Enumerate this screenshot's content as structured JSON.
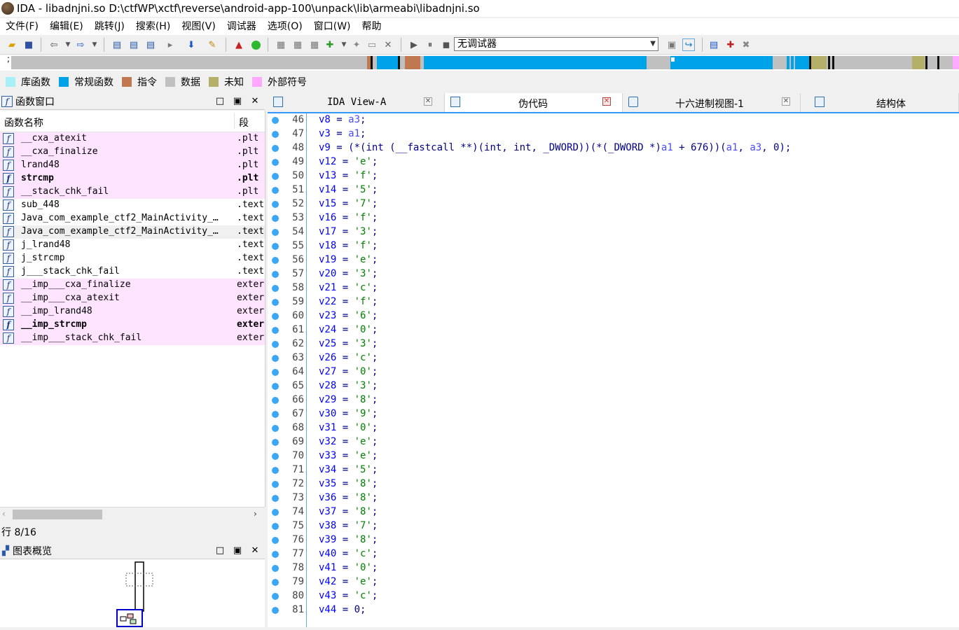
{
  "window": {
    "title": "IDA - libadnjni.so D:\\ctfWP\\xctf\\reverse\\android-app-100\\unpack\\lib\\armeabi\\libadnjni.so"
  },
  "menu": [
    "文件(F)",
    "编辑(E)",
    "跳转(J)",
    "搜索(H)",
    "视图(V)",
    "调试器",
    "选项(O)",
    "窗口(W)",
    "帮助"
  ],
  "toolbar": {
    "debugger_select": "无调试器"
  },
  "nav_band": {
    "prefix": ";"
  },
  "legend": [
    {
      "label": "库函数",
      "color": "#a8f0f8"
    },
    {
      "label": "常规函数",
      "color": "#00a2e8"
    },
    {
      "label": "指令",
      "color": "#c07850"
    },
    {
      "label": "数据",
      "color": "#c0c0c0"
    },
    {
      "label": "未知",
      "color": "#b4b06a"
    },
    {
      "label": "外部符号",
      "color": "#ffa8ff"
    }
  ],
  "functions_window": {
    "title": "函数窗口",
    "col_name": "函数名称",
    "col_segment": "段",
    "rows": [
      {
        "name": "__cxa_atexit",
        "segment": ".plt"
      },
      {
        "name": "__cxa_finalize",
        "segment": ".plt"
      },
      {
        "name": "lrand48",
        "segment": ".plt"
      },
      {
        "name": "strcmp",
        "segment": ".plt"
      },
      {
        "name": "__stack_chk_fail",
        "segment": ".plt"
      },
      {
        "name": "sub_448",
        "segment": ".text"
      },
      {
        "name": "Java_com_example_ctf2_MainActivity_…",
        "segment": ".text"
      },
      {
        "name": "Java_com_example_ctf2_MainActivity_…",
        "segment": ".text"
      },
      {
        "name": "j_lrand48",
        "segment": ".text"
      },
      {
        "name": "j_strcmp",
        "segment": ".text"
      },
      {
        "name": "j___stack_chk_fail",
        "segment": ".text"
      },
      {
        "name": "__imp___cxa_finalize",
        "segment": "exter"
      },
      {
        "name": "__imp___cxa_atexit",
        "segment": "exter"
      },
      {
        "name": "__imp_lrand48",
        "segment": "exter"
      },
      {
        "name": "__imp_strcmp",
        "segment": "exter"
      },
      {
        "name": "__imp___stack_chk_fail",
        "segment": "exter"
      }
    ],
    "row_count": "行 8/16"
  },
  "graph_overview": {
    "title": "图表概览"
  },
  "tabs": [
    {
      "label": "IDA View-A"
    },
    {
      "label": "伪代码"
    },
    {
      "label": "十六进制视图-1"
    },
    {
      "label": "结构体"
    }
  ],
  "code": {
    "line48": {
      "pre": "(*(int (__fastcall **)(int, int, _DWORD))(*(_DWORD *)",
      "a1": "a1",
      "mid": " + 676))(",
      "args_a1": "a1",
      ", ": ", ",
      "args_a3": "a3",
      "post": ", 0);"
    },
    "lines": [
      {
        "n": "46",
        "var": "v8",
        "rhs": "a3",
        "kind": "arg"
      },
      {
        "n": "47",
        "var": "v3",
        "rhs": "a1",
        "kind": "arg"
      },
      {
        "n": "48",
        "var": "v9",
        "rhs": "",
        "kind": "call"
      },
      {
        "n": "49",
        "var": "v12",
        "rhs": "'e'",
        "kind": "str"
      },
      {
        "n": "50",
        "var": "v13",
        "rhs": "'f'",
        "kind": "str"
      },
      {
        "n": "51",
        "var": "v14",
        "rhs": "'5'",
        "kind": "str"
      },
      {
        "n": "52",
        "var": "v15",
        "rhs": "'7'",
        "kind": "str"
      },
      {
        "n": "53",
        "var": "v16",
        "rhs": "'f'",
        "kind": "str"
      },
      {
        "n": "54",
        "var": "v17",
        "rhs": "'3'",
        "kind": "str"
      },
      {
        "n": "55",
        "var": "v18",
        "rhs": "'f'",
        "kind": "str"
      },
      {
        "n": "56",
        "var": "v19",
        "rhs": "'e'",
        "kind": "str"
      },
      {
        "n": "57",
        "var": "v20",
        "rhs": "'3'",
        "kind": "str"
      },
      {
        "n": "58",
        "var": "v21",
        "rhs": "'c'",
        "kind": "str"
      },
      {
        "n": "59",
        "var": "v22",
        "rhs": "'f'",
        "kind": "str"
      },
      {
        "n": "60",
        "var": "v23",
        "rhs": "'6'",
        "kind": "str"
      },
      {
        "n": "61",
        "var": "v24",
        "rhs": "'0'",
        "kind": "str"
      },
      {
        "n": "62",
        "var": "v25",
        "rhs": "'3'",
        "kind": "str"
      },
      {
        "n": "63",
        "var": "v26",
        "rhs": "'c'",
        "kind": "str"
      },
      {
        "n": "64",
        "var": "v27",
        "rhs": "'0'",
        "kind": "str"
      },
      {
        "n": "65",
        "var": "v28",
        "rhs": "'3'",
        "kind": "str"
      },
      {
        "n": "66",
        "var": "v29",
        "rhs": "'8'",
        "kind": "str"
      },
      {
        "n": "67",
        "var": "v30",
        "rhs": "'9'",
        "kind": "str"
      },
      {
        "n": "68",
        "var": "v31",
        "rhs": "'0'",
        "kind": "str"
      },
      {
        "n": "69",
        "var": "v32",
        "rhs": "'e'",
        "kind": "str"
      },
      {
        "n": "70",
        "var": "v33",
        "rhs": "'e'",
        "kind": "str"
      },
      {
        "n": "71",
        "var": "v34",
        "rhs": "'5'",
        "kind": "str"
      },
      {
        "n": "72",
        "var": "v35",
        "rhs": "'8'",
        "kind": "str"
      },
      {
        "n": "73",
        "var": "v36",
        "rhs": "'8'",
        "kind": "str"
      },
      {
        "n": "74",
        "var": "v37",
        "rhs": "'8'",
        "kind": "str"
      },
      {
        "n": "75",
        "var": "v38",
        "rhs": "'7'",
        "kind": "str"
      },
      {
        "n": "76",
        "var": "v39",
        "rhs": "'8'",
        "kind": "str"
      },
      {
        "n": "77",
        "var": "v40",
        "rhs": "'c'",
        "kind": "str"
      },
      {
        "n": "78",
        "var": "v41",
        "rhs": "'0'",
        "kind": "str"
      },
      {
        "n": "79",
        "var": "v42",
        "rhs": "'e'",
        "kind": "str"
      },
      {
        "n": "80",
        "var": "v43",
        "rhs": "'c'",
        "kind": "str"
      },
      {
        "n": "81",
        "var": "v44",
        "rhs": "0",
        "kind": "num"
      }
    ]
  }
}
